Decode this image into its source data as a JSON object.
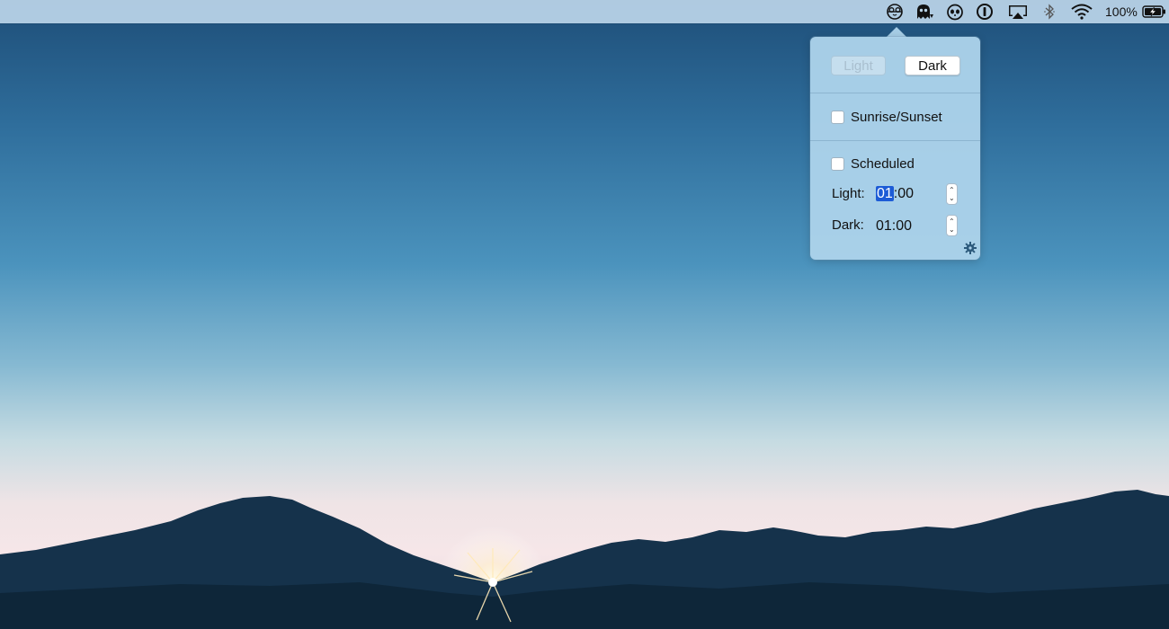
{
  "menubar": {
    "status_items": [
      "night-owl-icon",
      "ghost-icon",
      "panda-icon",
      "onepassword-icon",
      "airplay-icon",
      "bluetooth-icon",
      "wifi-icon"
    ],
    "battery_percent": "100%",
    "battery_charging": true
  },
  "popover": {
    "appearance_buttons": {
      "light": "Light",
      "dark": "Dark",
      "selected": "Dark"
    },
    "sunrise_sunset": {
      "label": "Sunrise/Sunset",
      "checked": false
    },
    "scheduled": {
      "label": "Scheduled",
      "checked": false
    },
    "light_time": {
      "label": "Light:",
      "hour": "01",
      "separator": ":",
      "minute": "00"
    },
    "dark_time": {
      "label": "Dark:",
      "value": "01:00"
    },
    "settings_icon": "gear-icon"
  },
  "colors": {
    "popover_bg": "#acd2ea",
    "highlight": "#1c5bd6",
    "mountains": "#0f2a40"
  }
}
